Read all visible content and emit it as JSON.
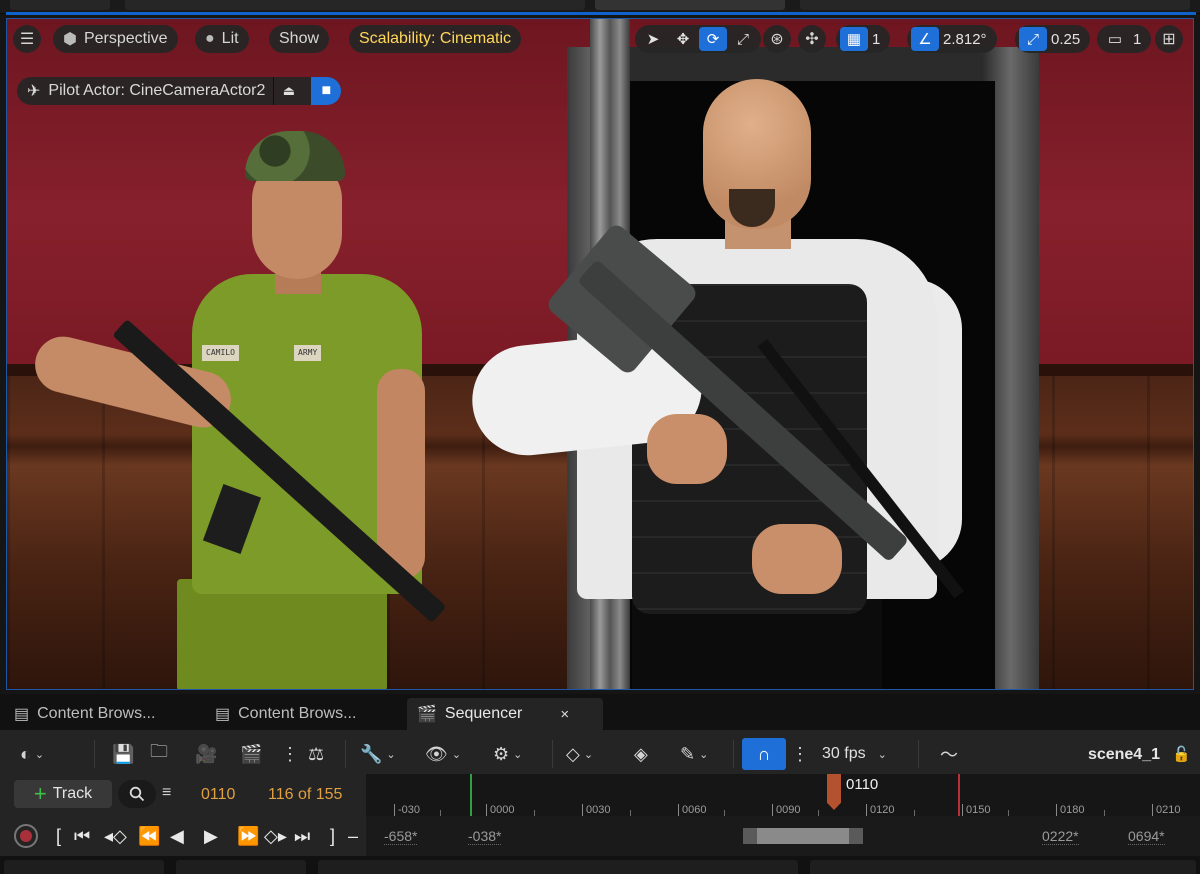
{
  "viewport": {
    "menu_icon": "hamburger-icon",
    "view_mode": "Perspective",
    "lighting_mode": "Lit",
    "show_label": "Show",
    "scalability": "Scalability: Cinematic",
    "grid_size": "1",
    "rotation_snap": "2.812°",
    "scale_snap": "0.25",
    "camera_speed": "1",
    "pilot_label": "Pilot Actor: CineCameraActor2",
    "shirt_tag_left": "CAMILO",
    "shirt_tag_right": "ARMY",
    "colors": {
      "accent_blue": "#1f6fd9",
      "scalability_yellow": "#ffd85a"
    }
  },
  "tabs": [
    {
      "label": "Content Brows...",
      "icon": "content-browser-icon"
    },
    {
      "label": "Content Brows...",
      "icon": "content-browser-icon"
    },
    {
      "label": "Sequencer",
      "icon": "clapperboard-icon",
      "close": "×"
    }
  ],
  "sequencer": {
    "fps": "30 fps",
    "scene_name": "scene4_1",
    "track_label": "Track",
    "current_frame": "0110",
    "frame_counter": "116 of 155",
    "playhead_label": "0110",
    "ruler_ticks": [
      "-030",
      "0000",
      "0030",
      "0060",
      "0090",
      "0120",
      "0150",
      "0180",
      "0210"
    ],
    "range": {
      "view_start": "-658*",
      "work_start": "-038*",
      "work_end": "0222*",
      "view_end": "0694*"
    },
    "colors": {
      "frame_orange": "#e0a040",
      "start_green": "#2ea043",
      "end_red": "#b9303a",
      "playhead": "#b4512e"
    }
  }
}
